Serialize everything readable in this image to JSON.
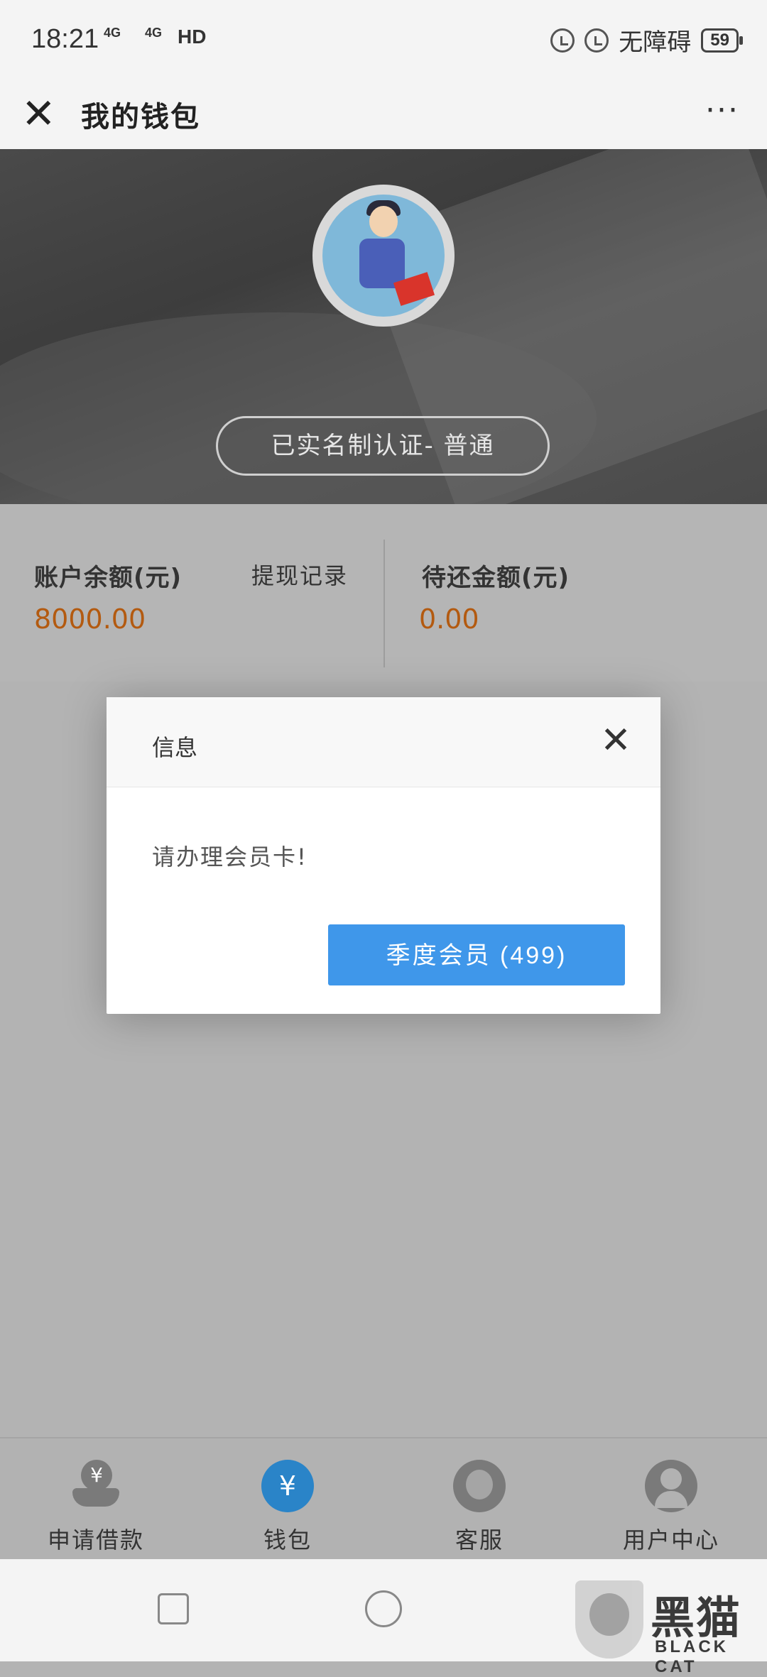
{
  "status_bar": {
    "time": "18:21",
    "signal1": "4G",
    "signal2": "4G",
    "hd": "HD",
    "accessibility": "无障碍",
    "battery": "59"
  },
  "title_bar": {
    "title": "我的钱包",
    "close_icon": "close-icon",
    "more_icon": "more-icon",
    "more_glyph": "···"
  },
  "header": {
    "verification_badge": "已实名制认证- 普通"
  },
  "stats": {
    "balance_label": "账户余额(元)",
    "balance_value": "8000.00",
    "withdraw_link": "提现记录",
    "due_label": "待还金额(元)",
    "due_value": "0.00"
  },
  "dialog": {
    "title": "信息",
    "message": "请办理会员卡!",
    "button": "季度会员 (499)"
  },
  "tabs": [
    {
      "label": "申请借款",
      "icon": "loan-icon"
    },
    {
      "label": "钱包",
      "icon": "wallet-icon",
      "glyph": "¥"
    },
    {
      "label": "客服",
      "icon": "customer-service-icon"
    },
    {
      "label": "用户中心",
      "icon": "user-icon"
    }
  ],
  "watermark": {
    "cn": "黑猫",
    "en": "BLACK CAT"
  },
  "colors": {
    "accent_blue": "#3f97ea",
    "value_orange": "#b35a10",
    "wallet_active": "#2a84c8"
  }
}
